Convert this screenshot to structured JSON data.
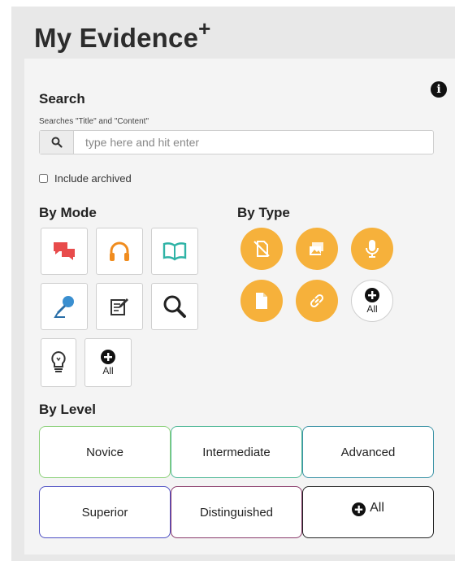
{
  "header": {
    "title": "My Evidence",
    "title_suffix": "+"
  },
  "search": {
    "heading": "Search",
    "hint": "Searches \"Title\" and \"Content\"",
    "placeholder": "type here and hit enter",
    "value": "",
    "include_archived_label": "Include archived",
    "include_archived_checked": false
  },
  "by_mode": {
    "heading": "By Mode",
    "items": [
      {
        "icon": "chat-bubbles-icon",
        "color": "#e84b4b"
      },
      {
        "icon": "headphones-icon",
        "color": "#f08c1e"
      },
      {
        "icon": "open-book-icon",
        "color": "#2fb3a6"
      },
      {
        "icon": "microphone-icon",
        "color": "#3a8fd0"
      },
      {
        "icon": "writing-icon",
        "color": "#333333"
      },
      {
        "icon": "magnifier-icon",
        "color": "#222222"
      },
      {
        "icon": "lightbulb-icon",
        "color": "#333333"
      },
      {
        "icon": "plus-circle-icon",
        "label": "All"
      }
    ]
  },
  "by_type": {
    "heading": "By Type",
    "accent": "#f6b13b",
    "items": [
      {
        "icon": "no-document-icon"
      },
      {
        "icon": "image-icon"
      },
      {
        "icon": "microphone-icon"
      },
      {
        "icon": "document-icon"
      },
      {
        "icon": "link-icon"
      },
      {
        "icon": "plus-circle-icon",
        "label": "All"
      }
    ]
  },
  "by_level": {
    "heading": "By Level",
    "items": [
      {
        "label": "Novice",
        "color": "#8cd17a"
      },
      {
        "label": "Intermediate",
        "color": "#4fb896"
      },
      {
        "label": "Advanced",
        "color": "#3c93a6"
      },
      {
        "label": "Superior",
        "color": "#4e4fc4"
      },
      {
        "label": "Distinguished",
        "color": "#8a3b6b"
      },
      {
        "label": "All",
        "color": "#222222",
        "icon": "plus-circle-icon"
      }
    ]
  }
}
